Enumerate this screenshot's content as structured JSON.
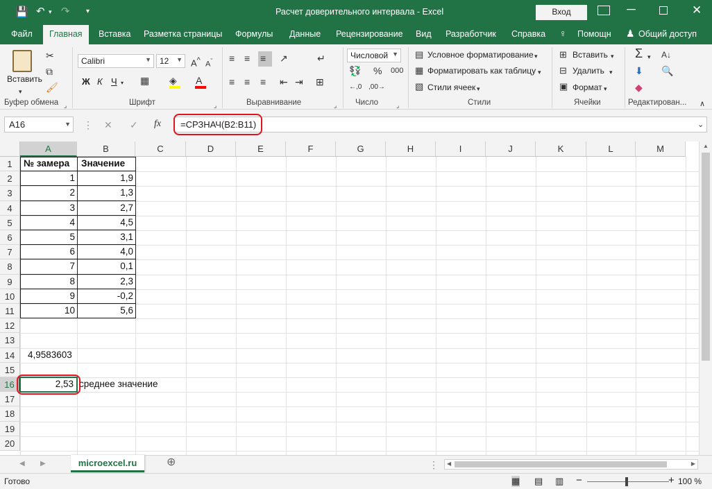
{
  "titlebar": {
    "title": "Расчет доверительного интервала  -  Excel",
    "signin": "Вход"
  },
  "tabs": [
    "Файл",
    "Главная",
    "Вставка",
    "Разметка страницы",
    "Формулы",
    "Данные",
    "Рецензирование",
    "Вид",
    "Разработчик",
    "Справка",
    "Помощн",
    "Общий доступ"
  ],
  "ribbon": {
    "clipboard": {
      "paste": "Вставить",
      "group": "Буфер обмена"
    },
    "font": {
      "name": "Calibri",
      "size": "12",
      "bold": "Ж",
      "italic": "К",
      "underline": "Ч",
      "group": "Шрифт"
    },
    "alignment": {
      "group": "Выравнивание"
    },
    "number": {
      "format": "Числовой",
      "group": "Число"
    },
    "styles": {
      "conditional": "Условное форматирование",
      "table": "Форматировать как таблицу",
      "cell": "Стили ячеек",
      "group": "Стили"
    },
    "cells": {
      "insert": "Вставить",
      "delete": "Удалить",
      "format": "Формат",
      "group": "Ячейки"
    },
    "editing": {
      "group": "Редактирован..."
    }
  },
  "formula_bar": {
    "name_box": "A16",
    "fx": "fx",
    "formula": "=СРЗНАЧ(B2:B11)"
  },
  "columns": [
    "A",
    "B",
    "C",
    "D",
    "E",
    "F",
    "G",
    "H",
    "I",
    "J",
    "K",
    "L",
    "M"
  ],
  "rows": [
    "1",
    "2",
    "3",
    "4",
    "5",
    "6",
    "7",
    "8",
    "9",
    "10",
    "11",
    "12",
    "13",
    "14",
    "15",
    "16",
    "17",
    "18",
    "19",
    "20"
  ],
  "table": {
    "header_a": "№ замера",
    "header_b": "Значение",
    "a": [
      "1",
      "2",
      "3",
      "4",
      "5",
      "6",
      "7",
      "8",
      "9",
      "10"
    ],
    "b": [
      "1,9",
      "1,3",
      "2,7",
      "4,5",
      "3,1",
      "4,0",
      "0,1",
      "2,3",
      "-0,2",
      "5,6"
    ]
  },
  "cells": {
    "a14": "4,9583603",
    "a16": "2,53",
    "b16": "среднее значение"
  },
  "sheet_tab": "microexcel.ru",
  "status": {
    "ready": "Готово",
    "zoom": "100 %"
  },
  "colors": {
    "accent": "#217346",
    "highlight": "#e0141e"
  }
}
